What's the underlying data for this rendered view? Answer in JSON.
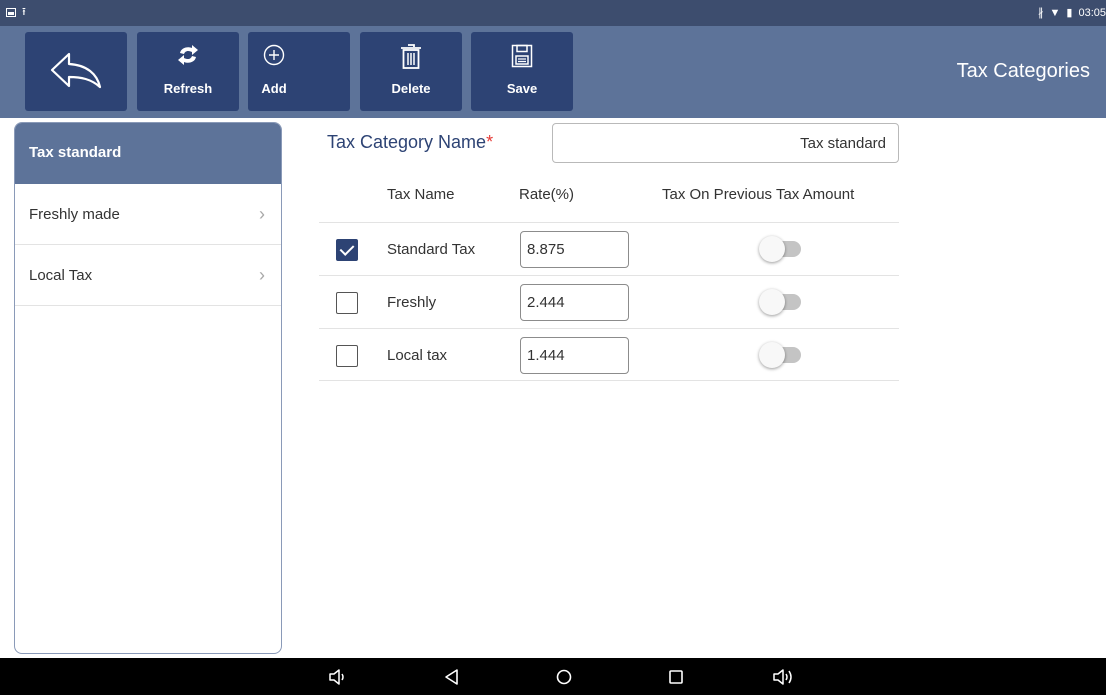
{
  "status_bar": {
    "time": "03:05",
    "left_icons": [
      "picture-icon",
      "upload-icon"
    ],
    "right_icons": [
      "bluetooth-icon",
      "wifi-icon",
      "battery-icon"
    ]
  },
  "toolbar": {
    "title": "Tax Categories",
    "buttons": [
      {
        "name": "back-button",
        "icon": "back-arrow-icon",
        "label": ""
      },
      {
        "name": "refresh-button",
        "icon": "refresh-icon",
        "label": "Refresh"
      },
      {
        "name": "add-button",
        "icon": "add-circle-icon",
        "label": "Add"
      },
      {
        "name": "delete-button",
        "icon": "trash-icon",
        "label": "Delete"
      },
      {
        "name": "save-button",
        "icon": "floppy-disk-icon",
        "label": "Save"
      }
    ],
    "colors": {
      "bar": "#5d7399",
      "button": "#2d4374"
    }
  },
  "sidebar": {
    "items": [
      {
        "label": "Tax standard",
        "active": true
      },
      {
        "label": "Freshly made",
        "active": false
      },
      {
        "label": "Local Tax",
        "active": false
      }
    ]
  },
  "form": {
    "category_label": "Tax Category Name",
    "required_mark": "*",
    "category_value": "Tax standard",
    "headers": {
      "tax_name": "Tax Name",
      "rate": "Rate(%)",
      "tax_on_previous": "Tax On Previous Tax Amount"
    },
    "rows": [
      {
        "checked": true,
        "tax_name": "Standard Tax",
        "rate": "8.875",
        "tax_on_previous": false
      },
      {
        "checked": false,
        "tax_name": "Freshly",
        "rate": "2.444",
        "tax_on_previous": false
      },
      {
        "checked": false,
        "tax_name": "Local tax",
        "rate": "1.444",
        "tax_on_previous": false
      }
    ]
  },
  "nav_bar": {
    "icons": [
      "volume-down-icon",
      "back-triangle-icon",
      "home-circle-icon",
      "recents-square-icon",
      "volume-up-icon"
    ]
  }
}
